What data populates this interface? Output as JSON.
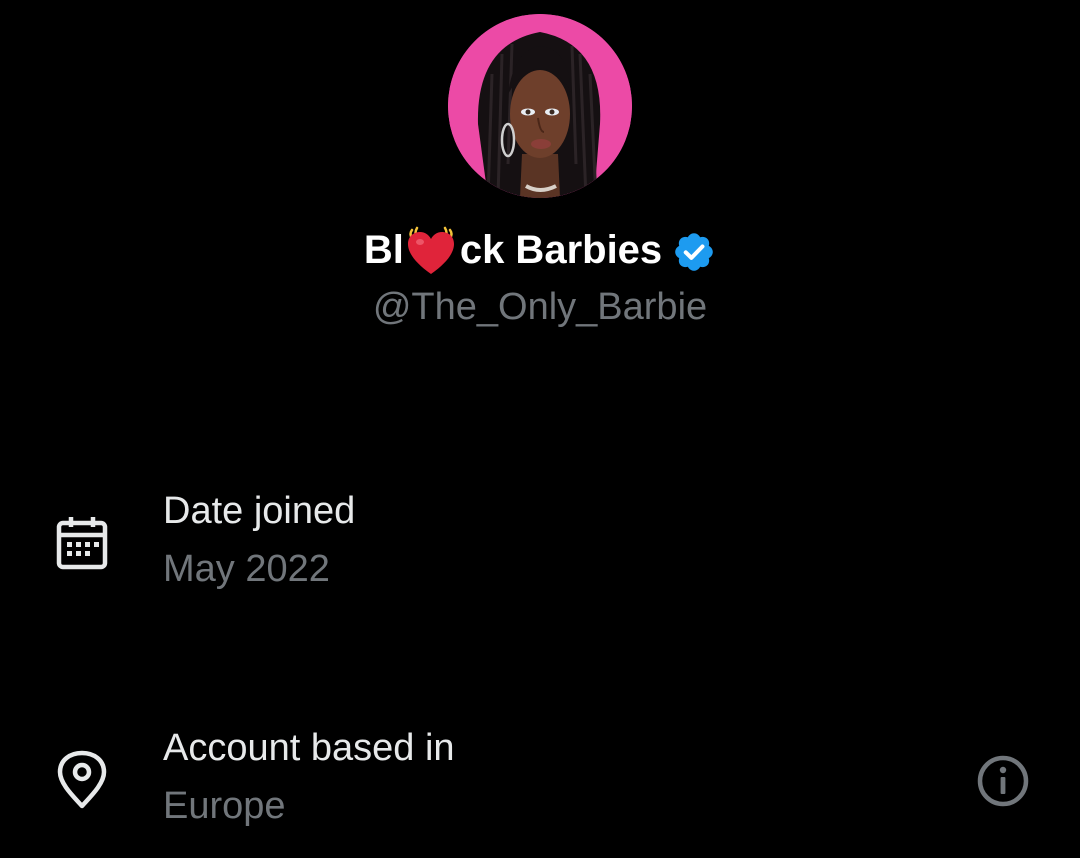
{
  "profile": {
    "display_name_prefix": "Bl",
    "display_name_suffix": "ck Barbies",
    "name_emoji": "beating-heart",
    "verified": true,
    "handle": "@The_Only_Barbie"
  },
  "details": {
    "date_joined": {
      "label": "Date joined",
      "value": "May 2022",
      "icon": "calendar-icon"
    },
    "account_location": {
      "label": "Account based in",
      "value": "Europe",
      "icon": "location-pin-icon",
      "info_icon": "info-icon"
    }
  },
  "colors": {
    "background": "#000000",
    "primary_text": "#e7e9ea",
    "secondary_text": "#71767b",
    "verified_blue": "#1d9bf0",
    "avatar_ring": "#ec4aa6",
    "heart_red": "#e0243a"
  }
}
